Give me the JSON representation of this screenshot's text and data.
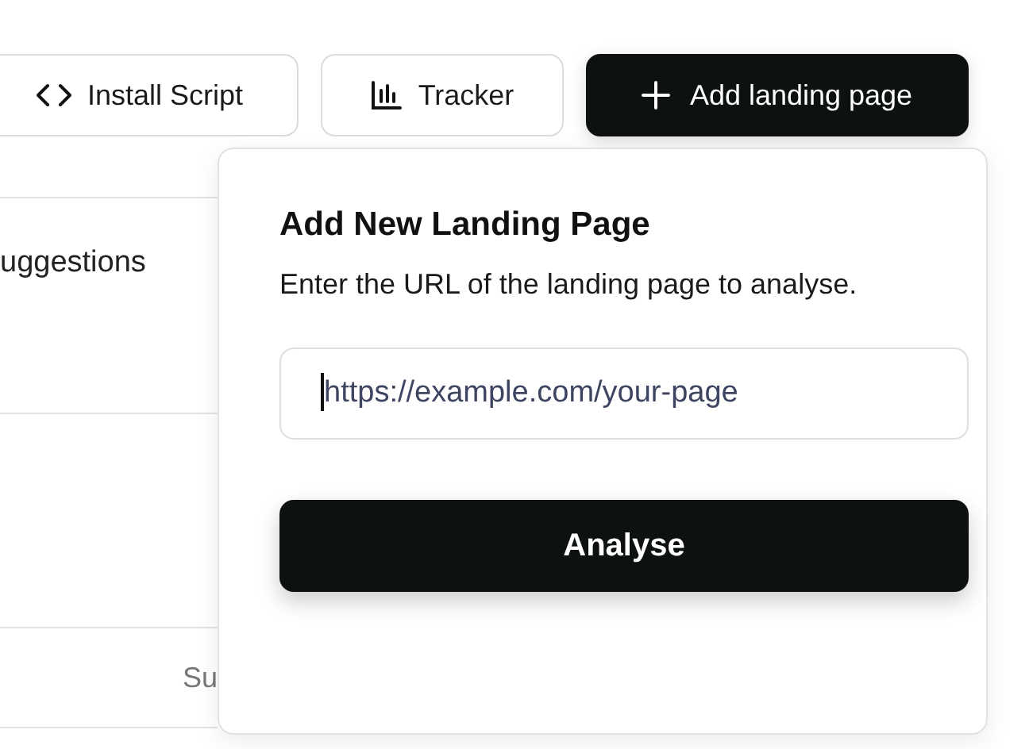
{
  "toolbar": {
    "buttons": [
      {
        "label": "Install Script",
        "kind": "code",
        "primary": false
      },
      {
        "label": "Tracker",
        "kind": "chart",
        "primary": false
      },
      {
        "label": "Add landing page",
        "kind": "add",
        "primary": true
      }
    ]
  },
  "table": {
    "rows": [
      {
        "kind": "title",
        "cell": "uggestions"
      },
      {
        "kind": "blank"
      },
      {
        "kind": "label",
        "cell": "Su"
      }
    ]
  },
  "popover": {
    "title": "Add New Landing Page",
    "description": "Enter the URL of the landing page to analyse.",
    "url_field": {
      "placeholder": "https://example.com/your-page"
    },
    "submit_button": "Analyse"
  }
}
